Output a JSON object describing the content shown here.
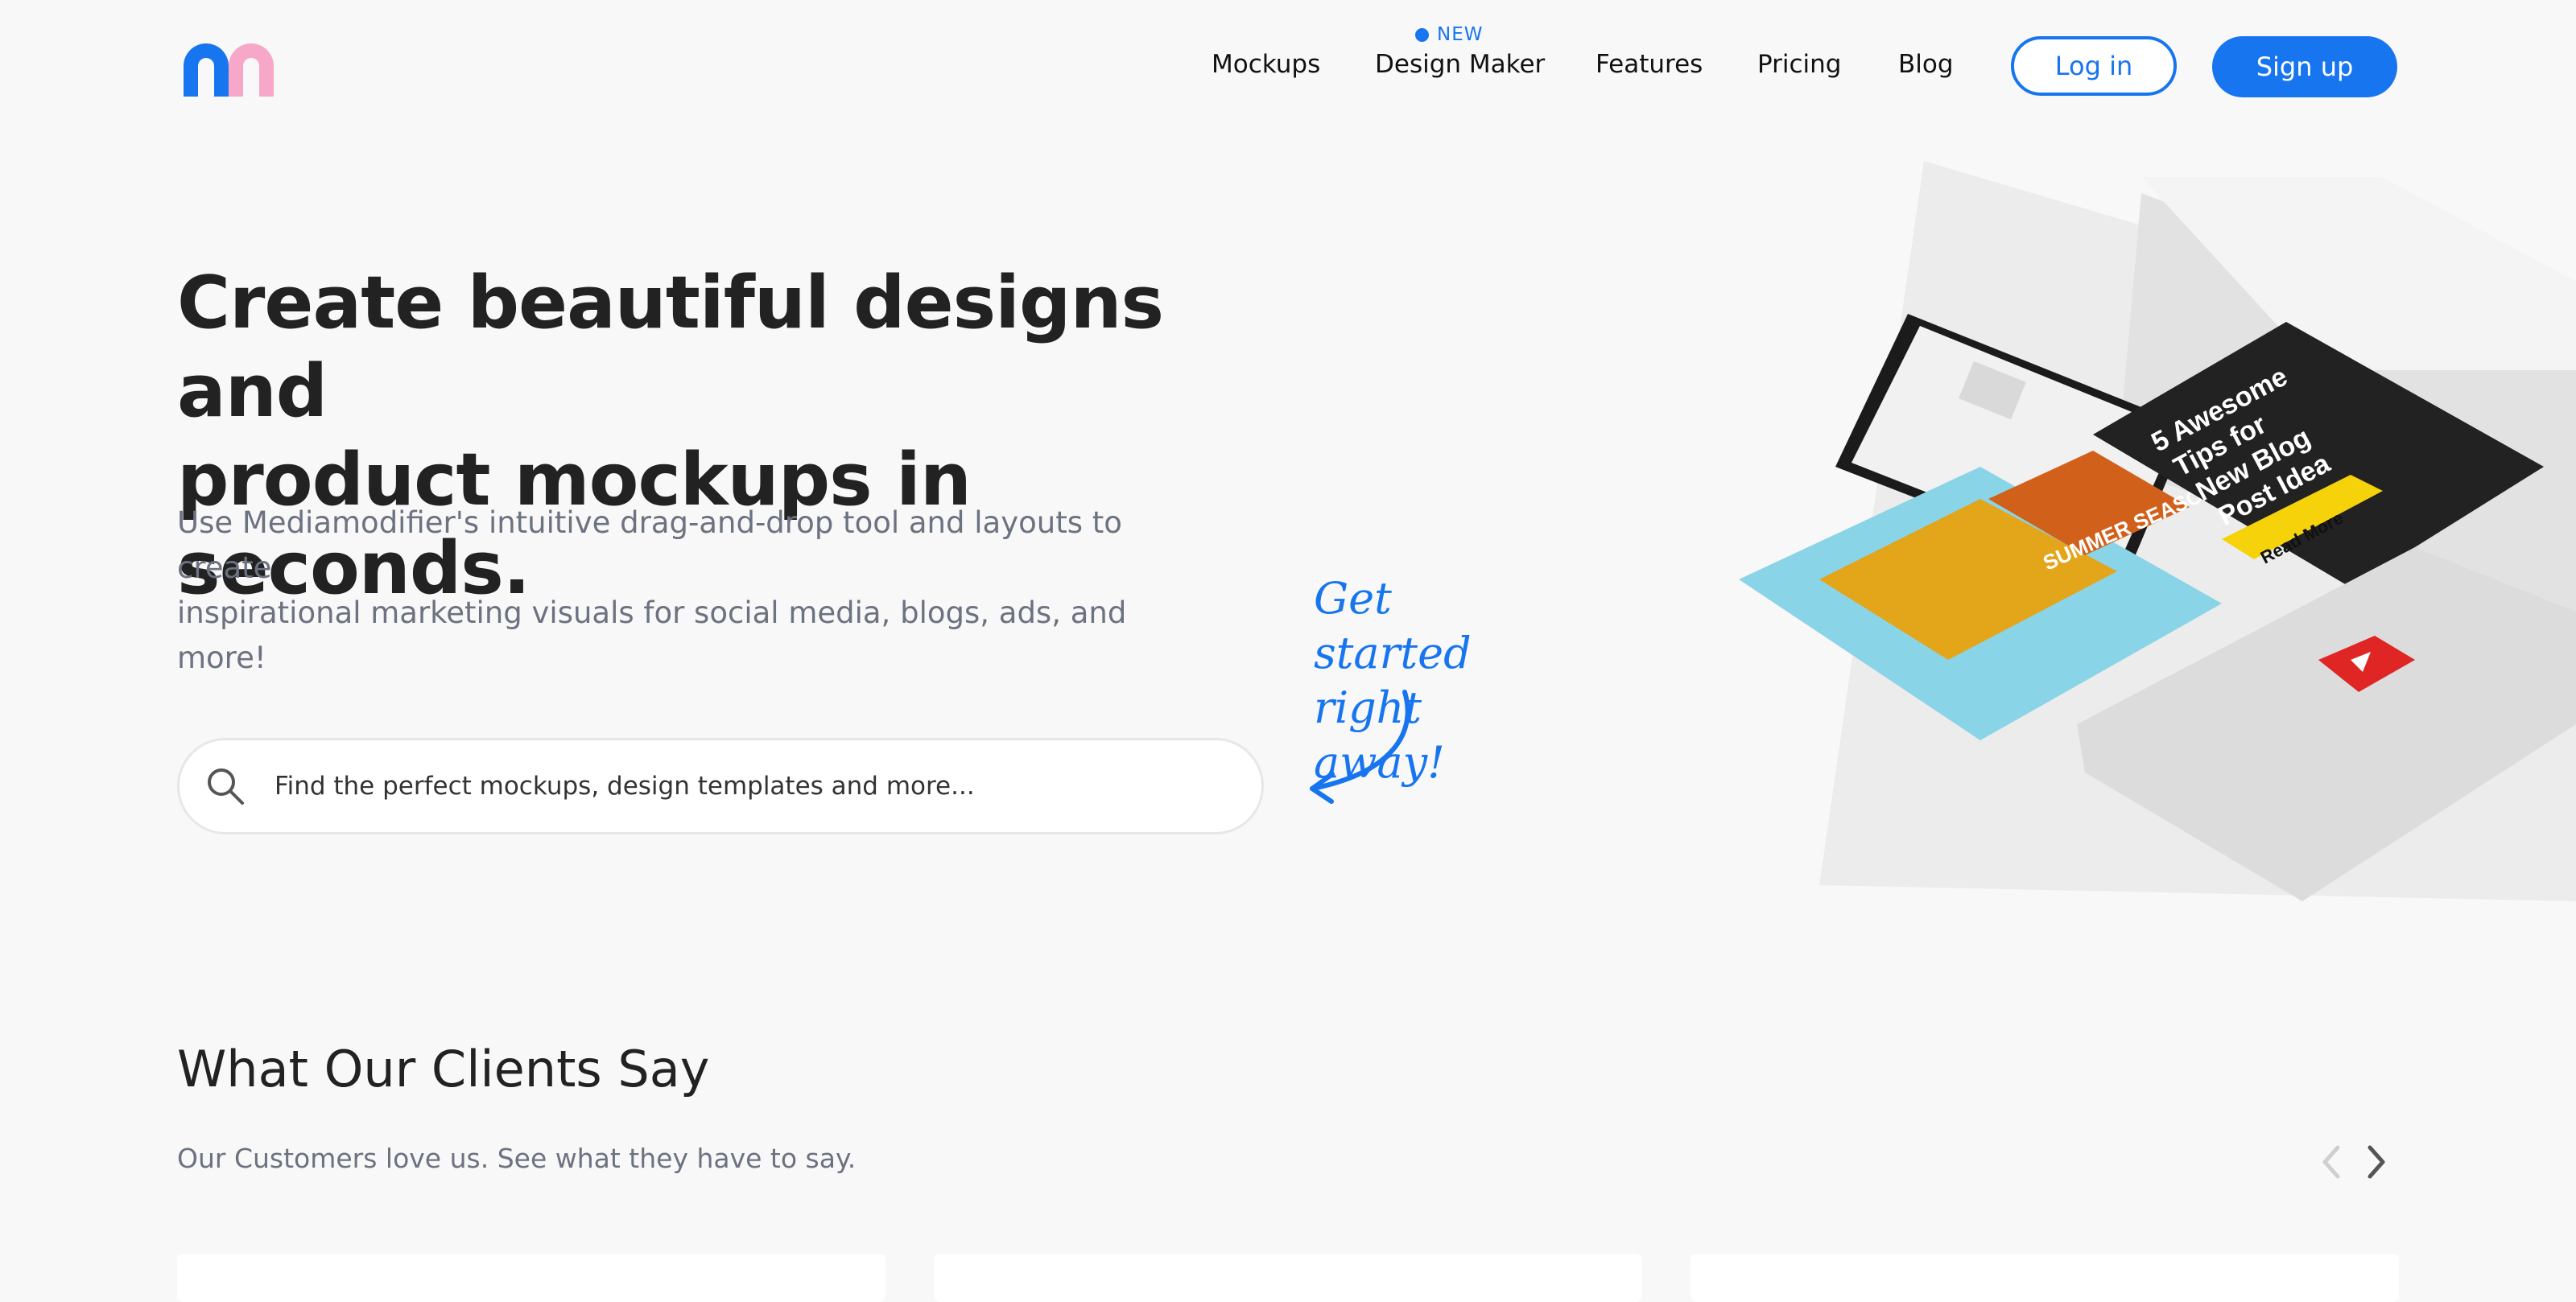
{
  "header": {
    "logo_icon": "mediamodifier-logo-icon",
    "nav": [
      {
        "label": "Mockups"
      },
      {
        "label": "Design Maker",
        "badge": "NEW"
      },
      {
        "label": "Features"
      },
      {
        "label": "Pricing"
      },
      {
        "label": "Blog"
      }
    ],
    "login_label": "Log in",
    "signup_label": "Sign up"
  },
  "hero": {
    "title_line1": "Create beautiful designs and",
    "title_line2": "product mockups in seconds.",
    "subtitle_line1": "Use Mediamodifier's intuitive drag-and-drop tool and layouts to create",
    "subtitle_line2": "inspirational marketing visuals for social media, blogs, ads, and more!",
    "callout_line1": "Get started",
    "callout_line2": "right away!",
    "search_placeholder": "Find the perfect mockups, design templates and more..."
  },
  "illustration": {
    "promo_card_1": "SUMMER SEASON OFFERS",
    "promo_card_2_line1": "5 Awesome",
    "promo_card_2_line2": "Tips for",
    "promo_card_2_line3": "New Blog",
    "promo_card_2_line4": "Post Idea",
    "promo_card_2_cta": "Read More"
  },
  "clients": {
    "title": "What Our Clients Say",
    "subtitle": "Our Customers love us. See what they have to say."
  },
  "colors": {
    "accent": "#1775f0",
    "logo_pink": "#f7a8c8",
    "background": "#f8f8f8"
  }
}
